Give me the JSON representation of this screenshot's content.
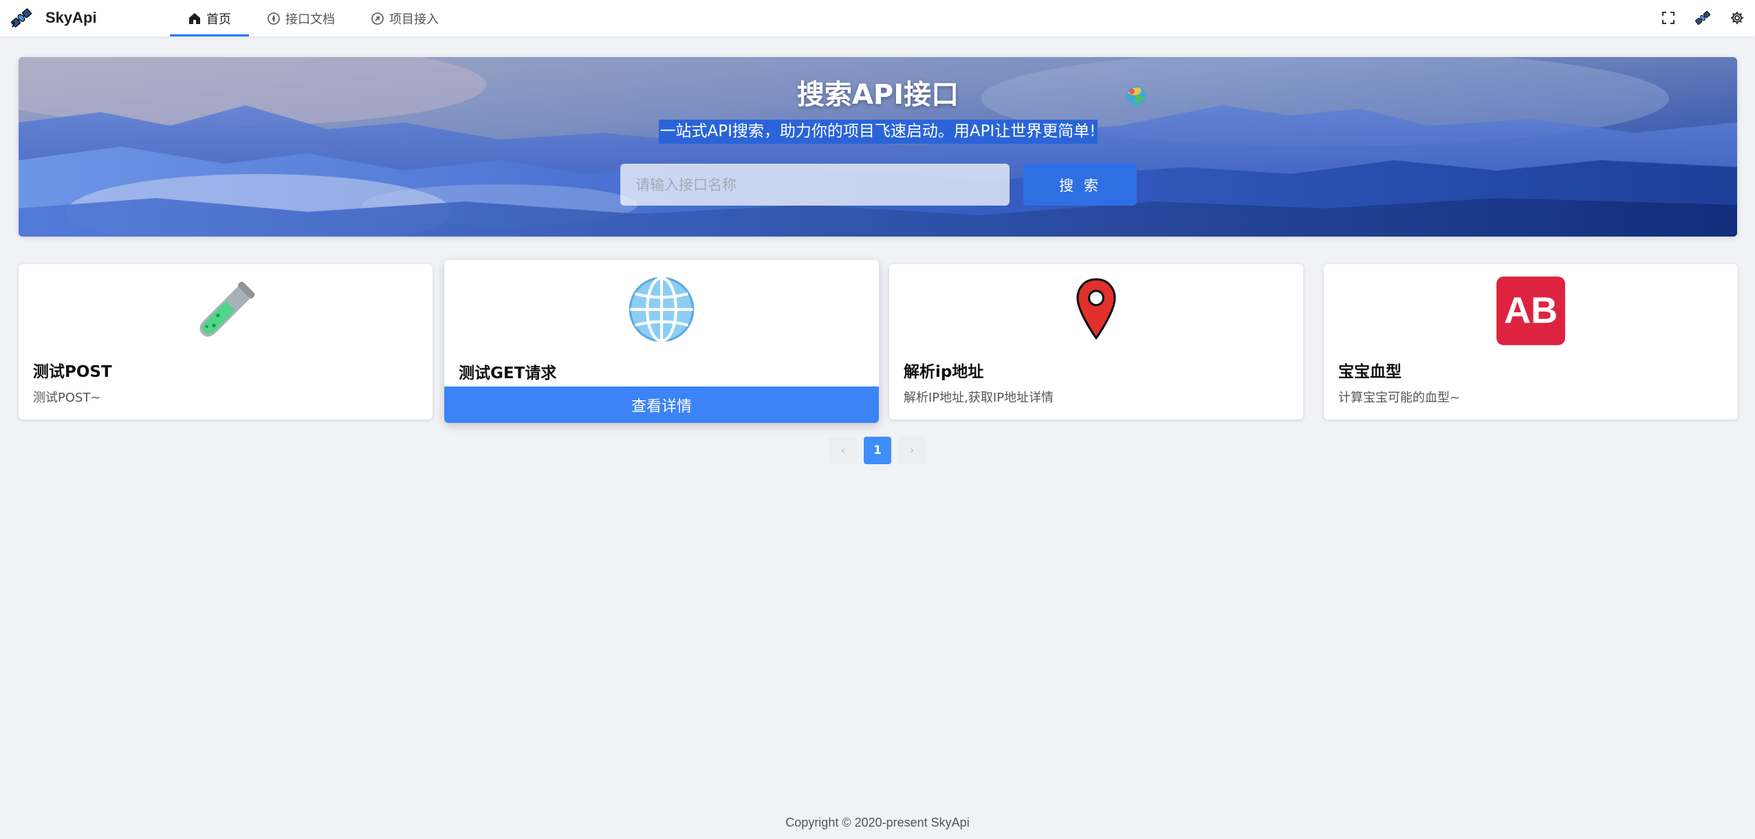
{
  "brand": {
    "name": "SkyApi",
    "logo_icon": "satellite-icon"
  },
  "nav": {
    "items": [
      {
        "label": "首页",
        "icon": "home-icon",
        "active": true
      },
      {
        "label": "接口文档",
        "icon": "compass-icon",
        "active": false
      },
      {
        "label": "项目接入",
        "icon": "link-circle-icon",
        "active": false
      }
    ],
    "actions": [
      {
        "icon": "fullscreen-icon"
      },
      {
        "icon": "satellite-icon"
      },
      {
        "icon": "gear-icon"
      }
    ]
  },
  "hero": {
    "title": "搜索API接口",
    "subtitle": "一站式API搜索，助力你的项目飞速启动。用API让世界更简单!",
    "search_placeholder": "请输入接口名称",
    "search_button": "搜 索"
  },
  "cards": [
    {
      "title": "测试POST",
      "desc": "测试POST~",
      "icon": "test-tube-icon",
      "hover": false
    },
    {
      "title": "测试GET请求",
      "desc": "",
      "icon": "globe-icon",
      "hover": true,
      "detail_label": "查看详情"
    },
    {
      "title": "解析ip地址",
      "desc": "解析IP地址,获取IP地址详情",
      "icon": "map-pin-icon",
      "hover": false
    },
    {
      "title": "宝宝血型",
      "desc": "计算宝宝可能的血型~",
      "icon": "ab-blood-type-icon",
      "icon_text": "AB",
      "hover": false
    }
  ],
  "pagination": {
    "prev": "‹",
    "current": "1",
    "next": "›"
  },
  "footer": {
    "copyright": "Copyright © 2020-present SkyApi"
  },
  "colors": {
    "accent": "#1677ff",
    "search_button": "#2f6fe4",
    "detail_bar": "#3b83f6",
    "page_bg": "#f0f2f5"
  }
}
